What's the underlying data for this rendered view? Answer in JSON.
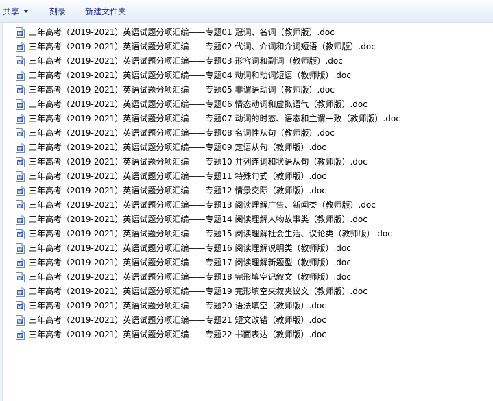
{
  "toolbar": {
    "share_label": "共享",
    "burn_label": "刻录",
    "new_folder_label": "新建文件夹"
  },
  "colors": {
    "toolbar_text": "#1e3287",
    "doc_icon_blue": "#2b62c4"
  },
  "file_icon": "word-doc-icon",
  "files": [
    "三年高考（2019-2021）英语试题分项汇编——专题01 冠词、名词（教师版）.doc",
    "三年高考（2019-2021）英语试题分项汇编——专题02 代词、介词和介词短语（教师版）.doc",
    "三年高考（2019-2021）英语试题分项汇编——专题03 形容词和副词（教师版）.doc",
    "三年高考（2019-2021）英语试题分项汇编——专题04 动词和动词短语（教师版）.doc",
    "三年高考（2019-2021）英语试题分项汇编——专题05 非谓语动词（教师版）.doc",
    "三年高考（2019-2021）英语试题分项汇编——专题06 情态动词和虚拟语气（教师版）.doc",
    "三年高考（2019-2021）英语试题分项汇编——专题07 动词的时态、语态和主谓一致（教师版）.doc",
    "三年高考（2019-2021）英语试题分项汇编——专题08 名词性从句（教师版）.doc",
    "三年高考（2019-2021）英语试题分项汇编——专题09 定语从句（教师版）.doc",
    "三年高考（2019-2021）英语试题分项汇编——专题10 并列连词和状语从句（教师版）.doc",
    "三年高考（2019-2021）英语试题分项汇编——专题11 特殊句式（教师版）.doc",
    "三年高考（2019-2021）英语试题分项汇编——专题12 情景交际（教师版）.doc",
    "三年高考（2019-2021）英语试题分项汇编——专题13 阅读理解广告、新闻类（教师版）.doc",
    "三年高考（2019-2021）英语试题分项汇编——专题14 阅读理解人物故事类（教师版）.doc",
    "三年高考（2019-2021）英语试题分项汇编——专题15 阅读理解社会生活、议论类（教师版）.doc",
    "三年高考（2019-2021）英语试题分项汇编——专题16 阅读理解说明类（教师版）.doc",
    "三年高考（2019-2021）英语试题分项汇编——专题17 阅读理解新题型（教师版）.doc",
    "三年高考（2019-2021）英语试题分项汇编——专题18 完形填空记叙文（教师版）.doc",
    "三年高考（2019-2021）英语试题分项汇编——专题19 完形填空夹叙夹议文（教师版）.doc",
    "三年高考（2019-2021）英语试题分项汇编——专题20 语法填空（教师版）.doc",
    "三年高考（2019-2021）英语试题分项汇编——专题21 短文改错（教师版）.doc",
    "三年高考（2019-2021）英语试题分项汇编——专题22 书面表达（教师版）.doc"
  ]
}
